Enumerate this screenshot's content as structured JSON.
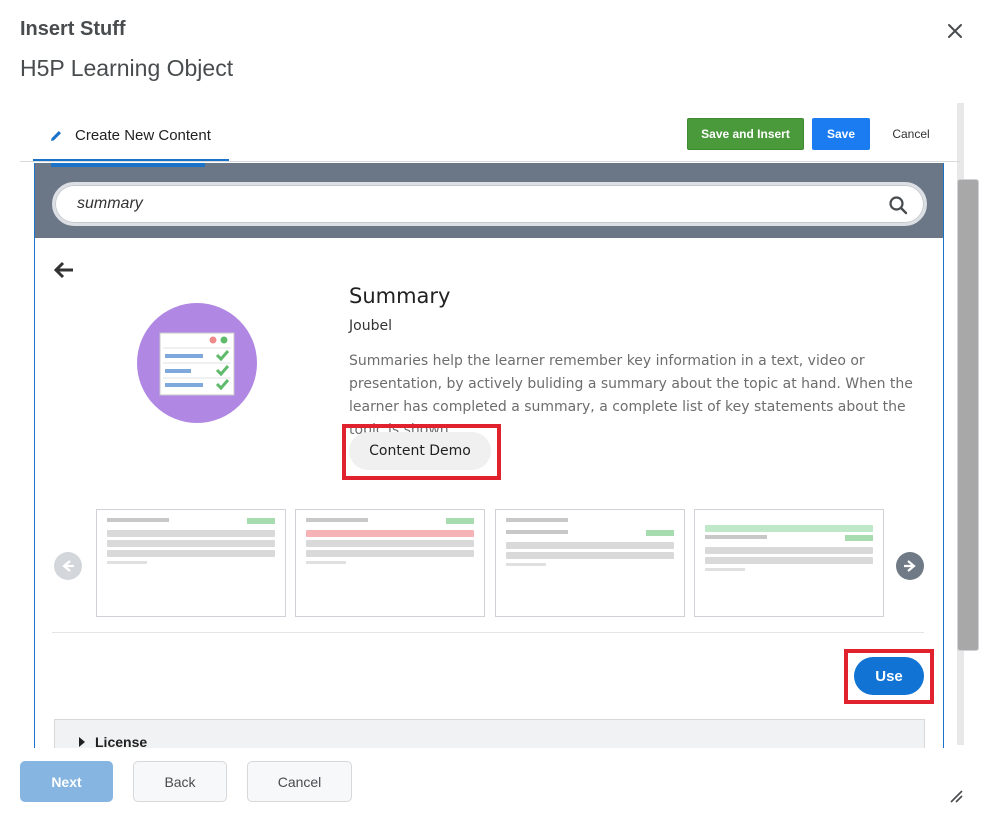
{
  "dialog": {
    "title": "Insert Stuff",
    "subtitle": "H5P Learning Object"
  },
  "editor": {
    "tab_label": "Create New Content",
    "save_insert_label": "Save and Insert",
    "save_label": "Save",
    "cancel_label": "Cancel"
  },
  "hub": {
    "search_value": "summary",
    "content_type": {
      "title": "Summary",
      "owner": "Joubel",
      "description": "Summaries help the learner remember key information in a text, video or presentation, by actively buliding a summary about the topic at hand. When the learner has completed a summary, a complete list of key statements about the topic is shown.",
      "demo_label": "Content Demo",
      "use_label": "Use",
      "license_label": "License"
    },
    "screenshot_count": 4
  },
  "footer": {
    "next_label": "Next",
    "back_label": "Back",
    "cancel_label": "Cancel"
  },
  "colors": {
    "primary_blue": "#1173d4",
    "save_green": "#4a9a3c",
    "highlight_red": "#e0222f",
    "hub_header": "#6b7787",
    "logo_purple": "#b088e3"
  },
  "icons": [
    "close-icon",
    "pencil-icon",
    "search-icon",
    "back-arrow-icon",
    "summary-logo-icon",
    "chevron-left-icon",
    "chevron-right-icon",
    "caret-right-icon",
    "resize-grip-icon"
  ]
}
